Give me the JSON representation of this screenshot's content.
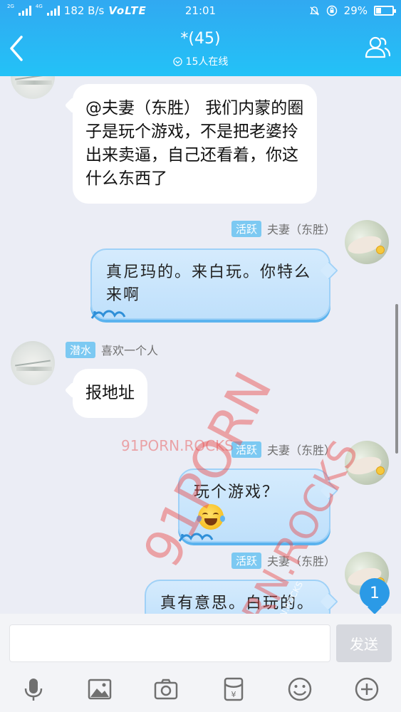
{
  "status_bar": {
    "network_2g": "2G",
    "network_4g": "4G",
    "speed": "182 B/s",
    "volte": "VoLTE",
    "time": "21:01",
    "battery": "29%"
  },
  "header": {
    "title": "*(45)",
    "online_text": "15人在线"
  },
  "messages": [
    {
      "side": "left",
      "text": "@夫妻（东胜） 我们内蒙的圈子是玩个游戏，不是把老婆拎出来卖逼，自己还看着，你这什么东西了"
    },
    {
      "side": "right",
      "badge": "活跃",
      "sender": "夫妻（东胜）",
      "text": "真尼玛的。来白玩。你特么来啊"
    },
    {
      "side": "left",
      "badge": "潜水",
      "sender": "喜欢一个人",
      "text": "报地址"
    },
    {
      "side": "right",
      "badge": "活跃",
      "sender": "夫妻（东胜）",
      "text": "玩个游戏？"
    },
    {
      "side": "right",
      "badge": "活跃",
      "sender": "夫妻（东胜）",
      "text": "真有意思。白玩的。"
    }
  ],
  "unread_count": "1",
  "watermarks": {
    "small": "91PORN.ROCKS",
    "large_1": "91PORN",
    "large_2": "91PORN.ROCKS",
    "tiny": "91PORN.ROCKS 91PORN.ROCKS"
  },
  "input": {
    "value": "",
    "placeholder": "",
    "send_label": "发送"
  },
  "toolbar": [
    "microphone-icon",
    "image-icon",
    "camera-icon",
    "red-packet-icon",
    "emoji-icon",
    "plus-icon"
  ],
  "colors": {
    "header_top": "#31a9f1",
    "header_bottom": "#23c2f7",
    "chat_bg": "#ebedf5",
    "badge": "#7cc9f2",
    "unread": "#2b9ae6",
    "watermark": "#e84646"
  }
}
